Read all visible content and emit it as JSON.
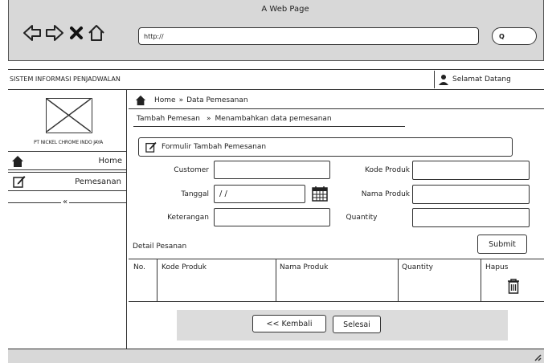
{
  "browser": {
    "title": "A Web Page",
    "url": "http://",
    "search_icon_text": "Q"
  },
  "app": {
    "title": "SISTEM INFORMASI PENJADWALAN",
    "greeting": "Selamat Datang"
  },
  "sidebar": {
    "company": "PT NICKEL CHROME INDO JAYA",
    "items": [
      {
        "label": "Home"
      },
      {
        "label": "Pemesanan"
      }
    ],
    "collapse": "«"
  },
  "breadcrumb": {
    "home": "Home",
    "sep": "»",
    "current": "Data Pemesanan"
  },
  "subcrumb": {
    "first": "Tambah Pemesan",
    "sep": "»",
    "second": "Menambahkan data pemesanan"
  },
  "form": {
    "title": "Formulir Tambah Pemesanan",
    "customer_label": "Customer",
    "customer_value": "",
    "tanggal_label": "Tanggal",
    "tanggal_value": "/ /",
    "keterangan_label": "Keterangan",
    "keterangan_value": "",
    "kode_produk_label": "Kode Produk",
    "kode_produk_value": "",
    "nama_produk_label": "Nama Produk",
    "nama_produk_value": "",
    "quantity_label": "Quantity",
    "quantity_value": ""
  },
  "detail": {
    "title": "Detail Pesanan",
    "submit": "Submit",
    "columns": [
      "No.",
      "Kode Produk",
      "Nama Produk",
      "Quantity",
      "Hapus"
    ]
  },
  "footer_buttons": {
    "back": "<< Kembali",
    "done": "Selesai"
  },
  "colors": {
    "chrome": "#d8d8d8",
    "footer_panel": "#dcdcdc",
    "line": "#333333"
  }
}
